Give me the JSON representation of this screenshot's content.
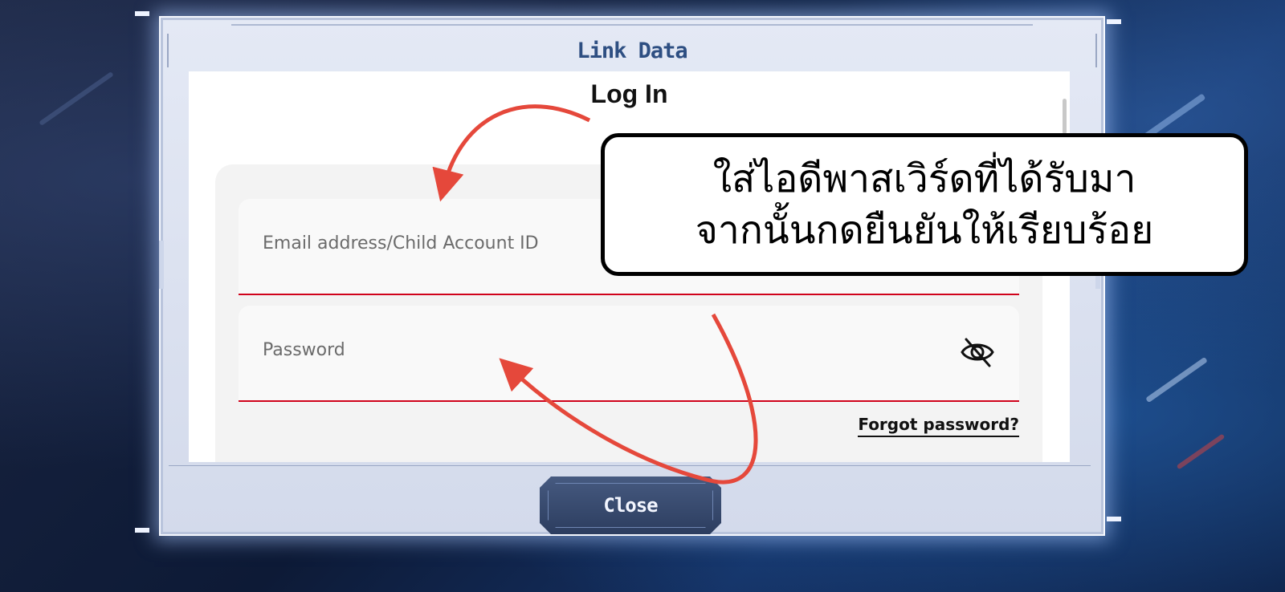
{
  "dialog": {
    "title": "Link Data",
    "heading": "Log In",
    "email_placeholder": "Email address/Child Account ID",
    "password_placeholder": "Password",
    "forgot_label": "Forgot password?",
    "close_label": "Close"
  },
  "annotation": {
    "line1": "ใส่ไอดีพาสเวิร์ดที่ได้รับมา",
    "line2": "จากนั้นกดยืนยันให้เรียบร้อย",
    "arrow_color": "#e5483b"
  },
  "icons": {
    "password_toggle": "eye-slash-icon"
  },
  "colors": {
    "accent_underline": "#d0021b",
    "title_color": "#2e4f82",
    "button_bg": "#2c3d5f"
  }
}
